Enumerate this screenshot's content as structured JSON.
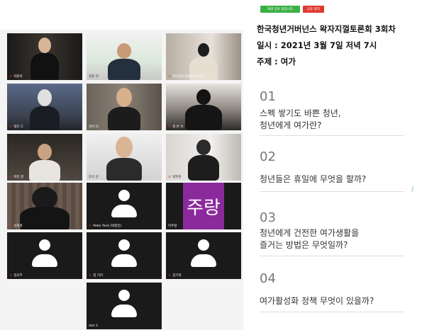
{
  "meeting": {
    "chip_left": "화면 공유 중입니다",
    "chip_right": "공유 중지"
  },
  "panel": {
    "title": "한국청년거버넌스 왁자지껄토론회 3회차",
    "date": "일시 : 2021년 3월 7일 저녁 7시",
    "topic": "주제 : 여가",
    "questions": [
      {
        "num": "01",
        "text": "스펙 쌓기도 바쁜 청년,\n청년에게 여가란?"
      },
      {
        "num": "02",
        "text": "청년들은 휴일에 무엇을 할까?"
      },
      {
        "num": "03",
        "text": "청년에게 건전한 여가생활을\n즐거는 방법은 무엇일까?"
      },
      {
        "num": "04",
        "text": "여가활성화 정책 무엇이 있을까?"
      }
    ]
  },
  "participants": [
    {
      "name": "차준의",
      "muted": true
    },
    {
      "name": "최준 희",
      "muted": false
    },
    {
      "name": "외국청년거버넌스외교부",
      "muted": true
    },
    {
      "name": "정인 드",
      "muted": true
    },
    {
      "name": "김어 다",
      "muted": false
    },
    {
      "name": "정 반 석",
      "muted": true
    },
    {
      "name": "혁진 권",
      "muted": true
    },
    {
      "name": "조호 빈",
      "muted": false
    },
    {
      "name": "박지훈",
      "muted": true
    },
    {
      "name": "선희원",
      "muted": true
    },
    {
      "name": "Peter Park (박창민)",
      "muted": true
    },
    {
      "name": "이주랑",
      "muted": false,
      "initials": "주랑"
    },
    {
      "name": "김모부",
      "muted": true
    },
    {
      "name": "김 기리",
      "muted": true
    },
    {
      "name": "김기현",
      "muted": true
    },
    {
      "name": "star 2",
      "muted": false
    }
  ]
}
